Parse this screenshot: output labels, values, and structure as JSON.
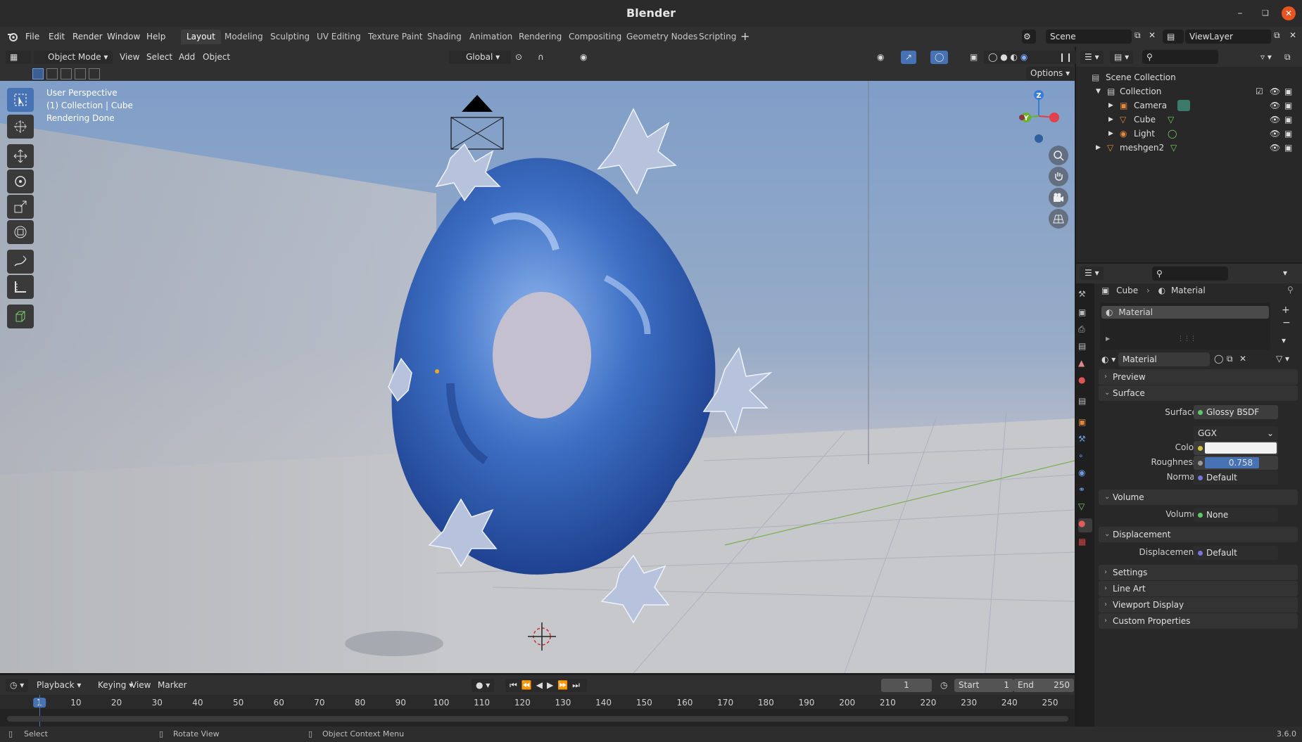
{
  "window": {
    "title": "Blender"
  },
  "menus": {
    "file": "File",
    "edit": "Edit",
    "render": "Render",
    "window": "Window",
    "help": "Help"
  },
  "workspaces": [
    "Layout",
    "Modeling",
    "Sculpting",
    "UV Editing",
    "Texture Paint",
    "Shading",
    "Animation",
    "Rendering",
    "Compositing",
    "Geometry Nodes",
    "Scripting"
  ],
  "active_workspace": "Layout",
  "scene": {
    "name": "Scene",
    "view_layer": "ViewLayer"
  },
  "viewport_header": {
    "mode": "Object Mode",
    "view": "View",
    "select": "Select",
    "add": "Add",
    "object": "Object",
    "orientation": "Global",
    "options": "Options"
  },
  "viewport_overlay": {
    "perspective": "User Perspective",
    "collection": "(1) Collection | Cube",
    "status": "Rendering Done"
  },
  "gizmo": {
    "z": "Z",
    "y": "Y"
  },
  "outliner": {
    "root": "Scene Collection",
    "items": [
      {
        "label": "Collection",
        "icon": "collection-icon"
      },
      {
        "label": "Camera",
        "icon": "camera-icon"
      },
      {
        "label": "Cube",
        "icon": "mesh-icon"
      },
      {
        "label": "Light",
        "icon": "light-icon"
      },
      {
        "label": "meshgen2",
        "icon": "mesh-icon"
      }
    ]
  },
  "properties": {
    "breadcrumb_object": "Cube",
    "breadcrumb_material": "Material",
    "slot": "Material",
    "material_name": "Material",
    "panels": {
      "preview": "Preview",
      "surface": "Surface",
      "volume": "Volume",
      "displacement": "Displacement",
      "settings": "Settings",
      "line_art": "Line Art",
      "viewport_display": "Viewport Display",
      "custom_properties": "Custom Properties"
    },
    "surface_label": "Surface",
    "surface_value": "Glossy BSDF",
    "distribution": "GGX",
    "color_label": "Color",
    "roughness_label": "Roughness",
    "roughness_value": "0.758",
    "roughness_fraction": 0.758,
    "normal_label": "Normal",
    "normal_value": "Default",
    "volume_label": "Volume",
    "volume_value": "None",
    "displacement_label": "Displacement",
    "displacement_value": "Default"
  },
  "timeline": {
    "playback": "Playback",
    "keying": "Keying",
    "view": "View",
    "marker": "Marker",
    "current_frame": "1",
    "start_label": "Start",
    "start": "1",
    "end_label": "End",
    "end": "250",
    "ticks": [
      "1",
      "10",
      "20",
      "30",
      "40",
      "50",
      "60",
      "70",
      "80",
      "90",
      "100",
      "110",
      "120",
      "130",
      "140",
      "150",
      "160",
      "170",
      "180",
      "190",
      "200",
      "210",
      "220",
      "230",
      "240",
      "250"
    ]
  },
  "statusbar": {
    "select": "Select",
    "rotate": "Rotate View",
    "context": "Object Context Menu",
    "version": "3.6.0"
  },
  "colors": {
    "accent": "#4772b3",
    "close_button": "#e95420",
    "x_axis": "#e0414c",
    "y_axis": "#6ab22b",
    "z_axis": "#3b7bd8",
    "object_blue": "#3d6fc4"
  }
}
